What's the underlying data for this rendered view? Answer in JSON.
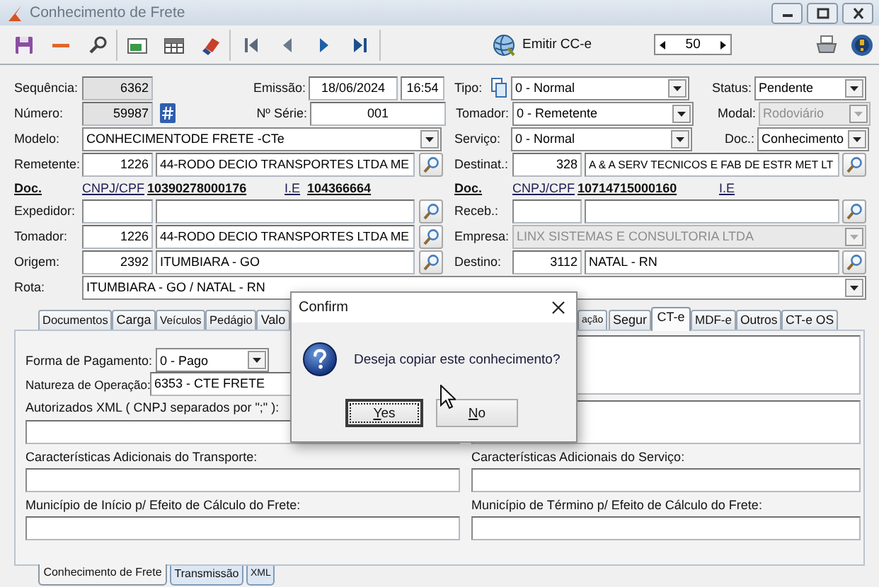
{
  "window": {
    "title": "Conhecimento de Frete"
  },
  "toolbar": {
    "emit_button": "Emitir CC-e",
    "counter": "50"
  },
  "form": {
    "rows": [
      [
        {
          "kind": "label",
          "text": "Sequência:"
        },
        {
          "kind": "field",
          "value": "6362",
          "readonly": true
        },
        {
          "kind": "label",
          "text": "Emissão:"
        },
        {
          "kind": "field",
          "value": "18/06/2024",
          "readonly": false
        },
        {
          "kind": "field",
          "value": "16:54",
          "readonly": false
        },
        {
          "kind": "label_copy",
          "text": "Tipo:"
        },
        {
          "kind": "combo",
          "value": "0 - Normal",
          "disabled": false
        },
        {
          "kind": "label",
          "text": "Status:"
        },
        {
          "kind": "combo",
          "value": "Pendente",
          "disabled": false
        }
      ],
      [
        {
          "kind": "label",
          "text": "Número:"
        },
        {
          "kind": "field_hash",
          "value": "59987",
          "readonly": true
        },
        {
          "kind": "label",
          "text": "Nº Série:"
        },
        {
          "kind": "field",
          "value": "001",
          "readonly": false
        },
        "",
        {
          "kind": "label",
          "text": "Tomador:"
        },
        {
          "kind": "combo",
          "value": "0 - Remetente",
          "disabled": false
        },
        {
          "kind": "label",
          "text": "Modal:"
        },
        {
          "kind": "combo",
          "value": "Rodoviário",
          "disabled": true
        }
      ],
      [
        {
          "kind": "label",
          "text": "Modelo:"
        },
        {
          "kind": "combo",
          "value": "CONHECIMENTODE FRETE -CTe",
          "disabled": false
        },
        "",
        "",
        "",
        {
          "kind": "label",
          "text": "Serviço:"
        },
        {
          "kind": "combo",
          "value": "0 - Normal",
          "disabled": false
        },
        {
          "kind": "label",
          "text": "Doc.:"
        },
        {
          "kind": "combo",
          "value": "Conhecimento",
          "disabled": false
        }
      ],
      [
        {
          "kind": "label",
          "text": "Remetente:"
        },
        {
          "kind": "field",
          "value": "1226",
          "readonly": false
        },
        {
          "kind": "field",
          "value": "44-RODO DECIO TRANSPORTES LTDA ME",
          "readonly": false
        },
        {
          "kind": "search"
        },
        {
          "kind": "label",
          "text": "Destinat.:"
        },
        {
          "kind": "field",
          "value": "328",
          "readonly": false
        },
        {
          "kind": "field",
          "value": "A & A SERV TECNICOS E FAB DE ESTR MET LT",
          "readonly": false
        },
        {
          "kind": "search"
        }
      ],
      [
        {
          "kind": "link",
          "text": "Doc.",
          "bold": true
        },
        {
          "kind": "link_pair",
          "label": "CNPJ/CPF",
          "value": "10390278000176"
        },
        {
          "kind": "link",
          "text": "I.E",
          "bold": false
        },
        {
          "kind": "link",
          "text": "104366664",
          "bold": true
        },
        "",
        {
          "kind": "link",
          "text": "Doc.",
          "bold": true
        },
        {
          "kind": "link_pair",
          "label": "CNPJ/CPF",
          "value": "10714715000160"
        },
        {
          "kind": "link",
          "text": "I.E",
          "bold": false
        }
      ],
      [
        {
          "kind": "label",
          "text": "Expedidor:"
        },
        {
          "kind": "field",
          "readonly": false
        },
        {
          "kind": "field",
          "readonly": false
        },
        {
          "kind": "search"
        },
        {
          "kind": "label",
          "text": "Receb.:"
        },
        {
          "kind": "field",
          "readonly": false
        },
        {
          "kind": "field",
          "readonly": false
        },
        {
          "kind": "search"
        }
      ],
      [
        {
          "kind": "label",
          "text": "Tomador:"
        },
        {
          "kind": "field",
          "value": "1226",
          "readonly": false
        },
        {
          "kind": "field",
          "value": "44-RODO DECIO TRANSPORTES LTDA ME",
          "readonly": false
        },
        {
          "kind": "search"
        },
        {
          "kind": "label",
          "text": "Empresa:"
        },
        {
          "kind": "combo",
          "value": "LINX SISTEMAS E CONSULTORIA LTDA",
          "disabled": true
        }
      ],
      [
        {
          "kind": "label",
          "text": "Origem:"
        },
        {
          "kind": "field",
          "value": "2392",
          "readonly": false
        },
        {
          "kind": "field",
          "value": "ITUMBIARA - GO",
          "readonly": false
        },
        {
          "kind": "search"
        },
        {
          "kind": "label",
          "text": "Destino:"
        },
        {
          "kind": "field",
          "value": "3112",
          "readonly": false
        },
        {
          "kind": "field",
          "value": "NATAL - RN",
          "readonly": false
        },
        {
          "kind": "search"
        }
      ],
      [
        {
          "kind": "label",
          "text": "Rota:"
        },
        {
          "kind": "combo",
          "value": "ITUMBIARA - GO / NATAL - RN",
          "disabled": false
        }
      ]
    ]
  },
  "tabs": [
    {
      "label": "Documentos",
      "selected": false
    },
    {
      "label": "Carga",
      "selected": false
    },
    {
      "label": "Veículos",
      "selected": false
    },
    {
      "label": "Pedágio",
      "selected": false
    },
    {
      "label": "Valo",
      "selected": false
    },
    {
      "label": "ação",
      "selected": false
    },
    {
      "label": "Segur",
      "selected": false
    },
    {
      "label": "CT-e",
      "selected": true
    },
    {
      "label": "MDF-e",
      "selected": false
    },
    {
      "label": "Outros",
      "selected": false
    },
    {
      "label": "CT-e OS",
      "selected": false
    }
  ],
  "cte_tab": {
    "payment": {
      "label": "Forma de Pagamento:",
      "value": "0 - Pago"
    },
    "operation": {
      "label": "Natureza de Operação:",
      "value": "6353 - CTE FRETE"
    },
    "authorized_xml": {
      "label": "Autorizados XML ( CNPJ separados por \";\" ):"
    },
    "transport_info": {
      "label": "Características Adicionais do Transporte:"
    },
    "service_info": {
      "label": "Características Adicionais do Serviço:"
    },
    "start_city": {
      "label": "Município de Início p/ Efeito de Cálculo do Frete:"
    },
    "end_city": {
      "label": "Município de Término p/ Efeito de Cálculo do Frete:"
    }
  },
  "bottom_tabs": [
    {
      "label": "Conhecimento de Frete",
      "selected": true
    },
    {
      "label": "Transmissão",
      "selected": false
    },
    {
      "label": "XML",
      "selected": false
    }
  ],
  "dialog": {
    "title": "Confirm",
    "message": "Deseja copiar este conhecimento?",
    "buttons": [
      {
        "label": "Yes",
        "focused": true
      },
      {
        "label": "No",
        "focused": false
      }
    ]
  }
}
